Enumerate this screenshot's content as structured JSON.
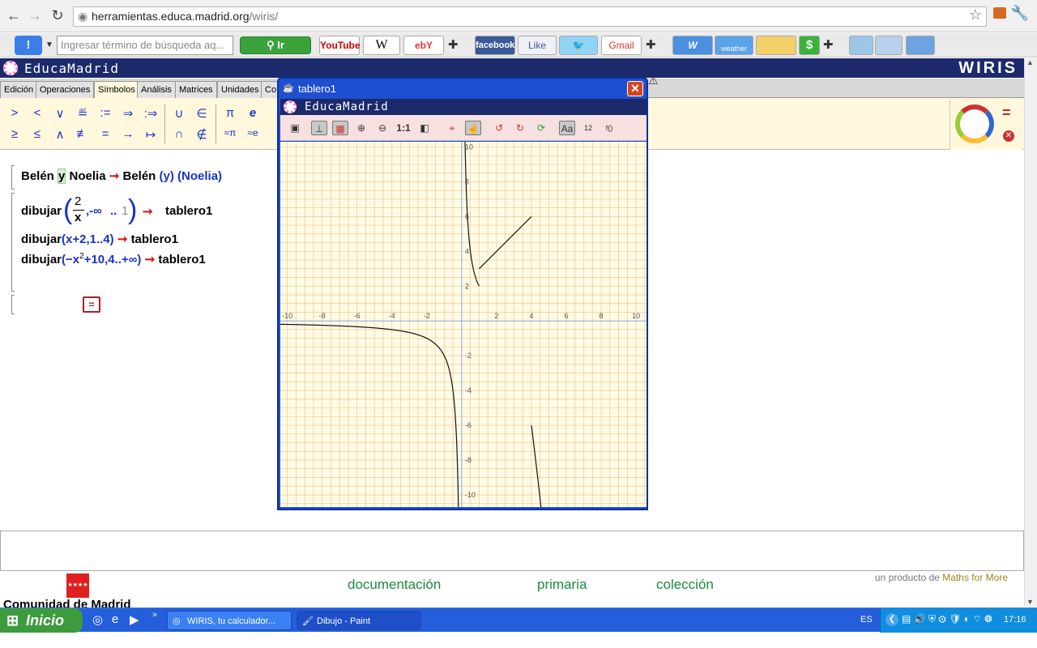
{
  "browser": {
    "url_host": "herramientas.educa.madrid.org",
    "url_path": "/wiris/"
  },
  "toolbar": {
    "search_placeholder": "Ingresar término de búsqueda aq...",
    "go_label": "Ir",
    "bookmarks": [
      "YouTube",
      "W",
      "ebY",
      "facebook",
      "Like",
      "",
      "Gmail",
      "W",
      "weather",
      "",
      "$"
    ]
  },
  "app": {
    "brand": "EducaMadrid",
    "product": "WIRIS",
    "tabs": [
      "Edición",
      "Operaciones",
      "Símbolos",
      "Análisis",
      "Matrices",
      "Unidades",
      "Co"
    ],
    "active_tab": "Símbolos",
    "symbols_row1": [
      ">",
      "<",
      "∨",
      "≝",
      ":=",
      "⇒",
      ":⇒",
      "∪",
      "∈",
      "π",
      "e"
    ],
    "symbols_row2": [
      "≥",
      "≤",
      "∧",
      "≢",
      "=",
      "→",
      "↦",
      "∩",
      "∉",
      "≈π",
      "≈e"
    ]
  },
  "worksheet": {
    "line1": {
      "a": "Belén",
      "b": "y",
      "c": "Noelia",
      "arrow": "➞",
      "r1": "Belén",
      "r2": "(y)",
      "r3": "(Noelia)"
    },
    "line2": {
      "fn": "dibujar",
      "num": "2",
      "den": "x",
      "range_start": ",-∞",
      "dots": "..",
      "range_end": "1",
      "arrow": "➞",
      "result": "tablero1"
    },
    "line3": {
      "fn": "dibujar",
      "args": "(x+2,1..4)",
      "arrow": "➞",
      "result": "tablero1"
    },
    "line4": {
      "fn": "dibujar",
      "args_a": "(−x",
      "exp": "2",
      "args_b": "+10,4..+∞)",
      "arrow": "➞",
      "result": "tablero1"
    },
    "eq_button": "="
  },
  "footer": {
    "links": [
      "documentación",
      "primaria",
      "colección"
    ],
    "credit_prefix": "un producto de",
    "credit_brand": "Maths for More",
    "comunidad": "Comunidad de Madrid"
  },
  "popup": {
    "title": "tablero1",
    "brand": "EducaMadrid",
    "zoom_label": "1:1",
    "graph": {
      "x_ticks": [
        -10,
        -8,
        -6,
        -4,
        -2,
        2,
        4,
        6,
        8,
        10
      ],
      "y_ticks": [
        10,
        8,
        6,
        4,
        2,
        -2,
        -4,
        -6,
        -8,
        -10
      ],
      "xlim": [
        -10.4,
        10.6
      ],
      "ylim": [
        -10.7,
        10.3
      ],
      "functions": [
        "2/x",
        "x+2",
        "-x^2+10"
      ]
    }
  },
  "taskbar": {
    "start": "Inicio",
    "tasks": [
      "WIRIS, tu calculador...",
      "Dibujo - Paint"
    ],
    "lang": "ES",
    "clock": "17:16"
  }
}
